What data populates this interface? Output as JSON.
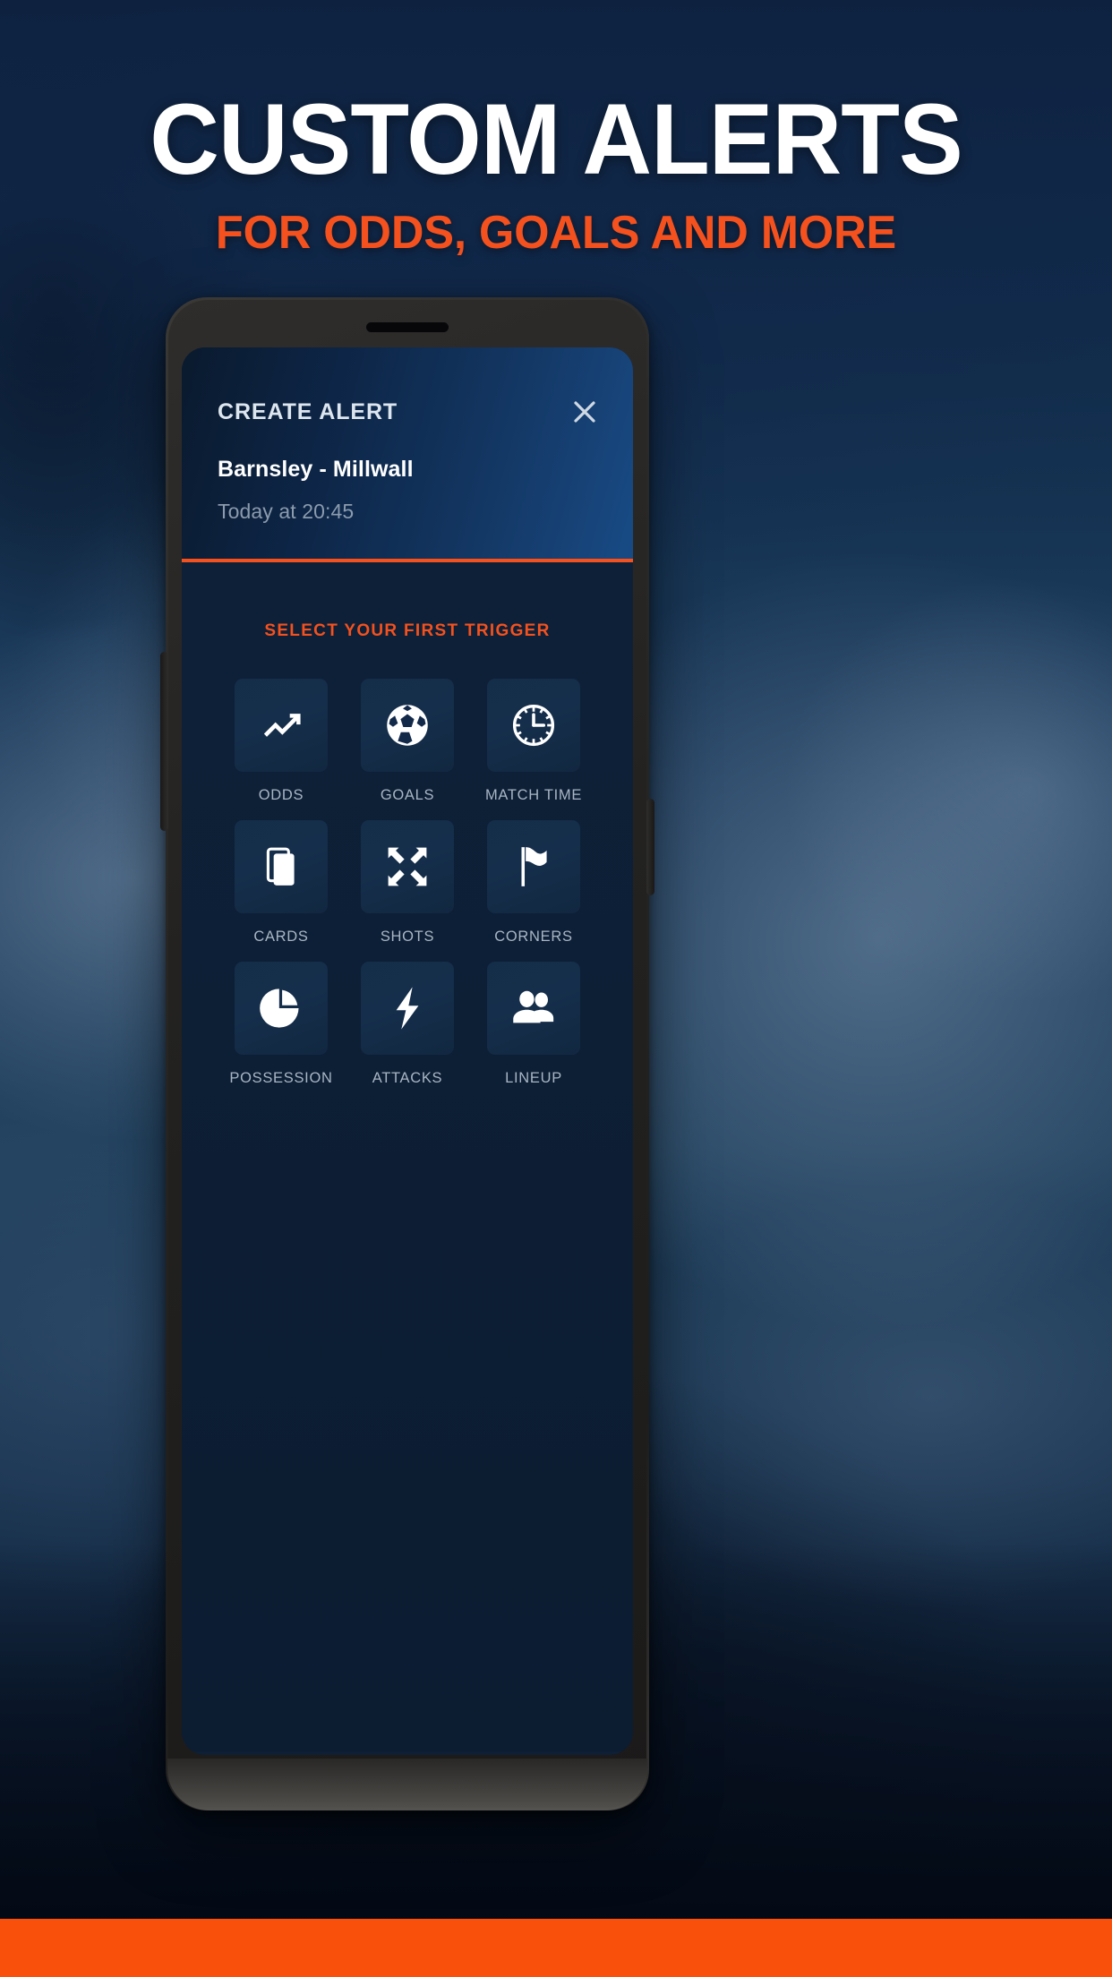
{
  "promo": {
    "headline": "CUSTOM ALERTS",
    "subheadline": "FOR ODDS, GOALS AND MORE"
  },
  "colors": {
    "accent_orange": "#f4511e",
    "bottom_bar_orange": "#f9500b",
    "background_navy": "#12304f",
    "screen_navy": "#0e2038",
    "tile_navy": "#15304c",
    "label_grey": "#a9b6c4",
    "muted_text": "#8b9bad",
    "white": "#ffffff"
  },
  "phone": {
    "speaker_icon": "speaker-grille-icon",
    "left_button_icon": "volume-button-icon",
    "right_button_icon": "power-button-icon"
  },
  "app": {
    "header": {
      "title": "CREATE ALERT",
      "close_icon": "close-x-icon",
      "match": "Barnsley - Millwall",
      "kickoff": "Today at 20:45"
    },
    "body": {
      "section_label": "SELECT YOUR FIRST TRIGGER",
      "triggers": [
        {
          "label": "ODDS",
          "icon": "trending-up-icon"
        },
        {
          "label": "GOALS",
          "icon": "soccer-ball-icon"
        },
        {
          "label": "MATCH TIME",
          "icon": "clock-icon"
        },
        {
          "label": "CARDS",
          "icon": "cards-icon"
        },
        {
          "label": "SHOTS",
          "icon": "converge-arrows-icon"
        },
        {
          "label": "CORNERS",
          "icon": "corner-flag-icon"
        },
        {
          "label": "POSSESSION",
          "icon": "pie-chart-icon"
        },
        {
          "label": "ATTACKS",
          "icon": "lightning-bolt-icon"
        },
        {
          "label": "LINEUP",
          "icon": "people-icon"
        }
      ]
    }
  }
}
